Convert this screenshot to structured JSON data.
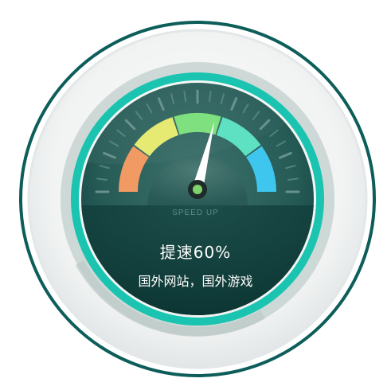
{
  "gauge": {
    "caption": "SPEED UP",
    "title": "提速60%",
    "subtitle": "国外网站，国外游戏",
    "level_percent": 60,
    "segment_colors": [
      "#f29a64",
      "#e6ea72",
      "#7ee07e",
      "#5ee0c2",
      "#3fc6ee"
    ],
    "accent_color": "#1bc4b0",
    "dark_color": "#0d3a37",
    "needle_color": "#ffffff",
    "hub_color": "#7ed36a"
  }
}
